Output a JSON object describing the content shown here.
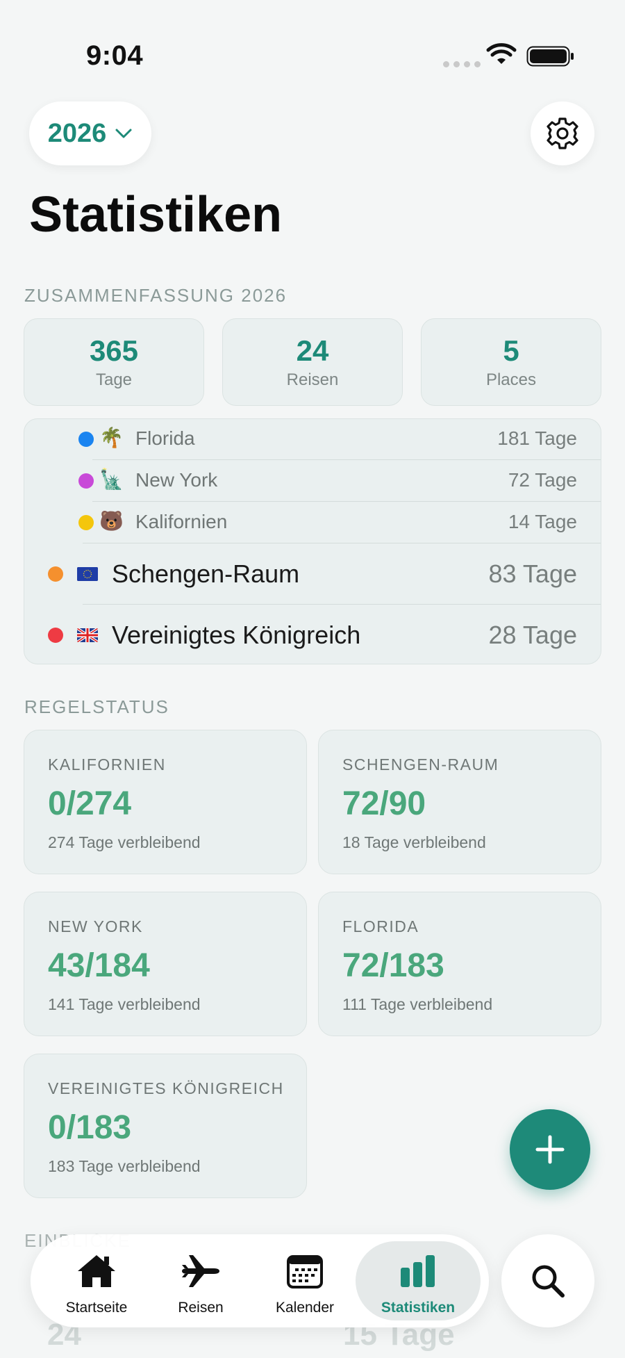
{
  "status_bar": {
    "time": "9:04"
  },
  "header": {
    "year": "2026",
    "title": "Statistiken"
  },
  "summary": {
    "section_label": "ZUSAMMENFASSUNG 2026",
    "cards": [
      {
        "value": "365",
        "label": "Tage"
      },
      {
        "value": "24",
        "label": "Reisen"
      },
      {
        "value": "5",
        "label": "Places"
      }
    ]
  },
  "breakdown": [
    {
      "name": "Florida",
      "days": "181 Tage",
      "emoji": "🌴",
      "color": "#1a84f0"
    },
    {
      "name": "New York",
      "days": "72 Tage",
      "emoji": "🗽",
      "color": "#c84ad8"
    },
    {
      "name": "Kalifornien",
      "days": "14 Tage",
      "emoji": "🐻",
      "color": "#f4c60c"
    },
    {
      "name": "Schengen-Raum",
      "days": "83 Tage",
      "emoji": "🇪🇺",
      "color": "#f5902e"
    },
    {
      "name": "Vereinigtes Königreich",
      "days": "28 Tage",
      "emoji": "🇬🇧",
      "color": "#ee3b43"
    }
  ],
  "rules": {
    "section_label": "REGELSTATUS",
    "cards": [
      {
        "title": "KALIFORNIEN",
        "value": "0/274",
        "remaining": "274 Tage verbleibend"
      },
      {
        "title": "SCHENGEN-RAUM",
        "value": "72/90",
        "remaining": "18 Tage verbleibend"
      },
      {
        "title": "NEW YORK",
        "value": "43/184",
        "remaining": "141 Tage verbleibend"
      },
      {
        "title": "FLORIDA",
        "value": "72/183",
        "remaining": "111 Tage verbleibend"
      },
      {
        "title": "VEREINIGTES KÖNIGREICH",
        "value": "0/183",
        "remaining": "183 Tage verbleibend"
      }
    ]
  },
  "insights": {
    "section_label": "EINBLICKE",
    "peek_left": "24",
    "peek_right": "15 Tage"
  },
  "tabbar": {
    "tabs": [
      {
        "label": "Startseite",
        "icon": "house-icon"
      },
      {
        "label": "Reisen",
        "icon": "airplane-icon"
      },
      {
        "label": "Kalender",
        "icon": "calendar-icon"
      },
      {
        "label": "Statistiken",
        "icon": "bar-chart-icon",
        "active": true
      }
    ]
  },
  "colors": {
    "accent": "#1d8a78",
    "rule_value": "#4aa77c",
    "card_bg": "#eaf0f0",
    "page_bg": "#f4f6f6"
  }
}
